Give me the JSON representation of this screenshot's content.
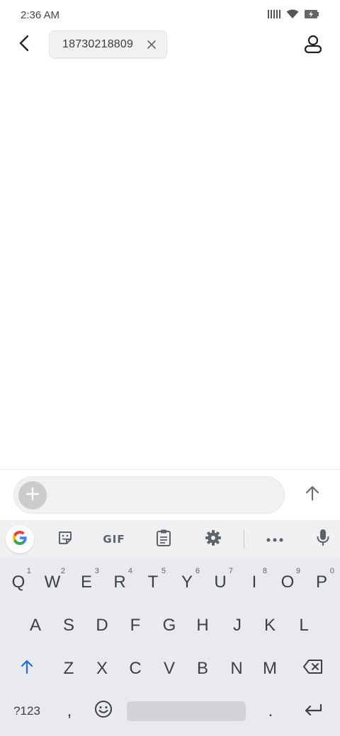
{
  "status_bar": {
    "time": "2:36 AM",
    "icons": [
      "signal-icon",
      "wifi-icon",
      "battery-charging-icon"
    ]
  },
  "header": {
    "recipient_chip": "18730218809",
    "icons": [
      "back-arrow-icon",
      "close-icon",
      "contact-icon"
    ]
  },
  "compose": {
    "placeholder": "",
    "icons": [
      "plus-icon",
      "send-arrow-icon"
    ]
  },
  "keyboard": {
    "toolbar": {
      "gif_label": "GIF",
      "icons": [
        "google-icon",
        "sticker-icon",
        "clipboard-icon",
        "settings-icon",
        "more-icon",
        "mic-icon"
      ]
    },
    "row1": [
      {
        "letter": "Q",
        "hint": "1"
      },
      {
        "letter": "W",
        "hint": "2"
      },
      {
        "letter": "E",
        "hint": "3"
      },
      {
        "letter": "R",
        "hint": "4"
      },
      {
        "letter": "T",
        "hint": "5"
      },
      {
        "letter": "Y",
        "hint": "6"
      },
      {
        "letter": "U",
        "hint": "7"
      },
      {
        "letter": "I",
        "hint": "8"
      },
      {
        "letter": "O",
        "hint": "9"
      },
      {
        "letter": "P",
        "hint": "0"
      }
    ],
    "row2": [
      "A",
      "S",
      "D",
      "F",
      "G",
      "H",
      "J",
      "K",
      "L"
    ],
    "row3": [
      "Z",
      "X",
      "C",
      "V",
      "B",
      "N",
      "M"
    ],
    "row4": {
      "symbols_label": "?123",
      "comma_label": ",",
      "period_label": "."
    },
    "colors": {
      "accent": "#1a73e8",
      "key_text": "#3c4043",
      "background": "#e8eaed"
    }
  }
}
